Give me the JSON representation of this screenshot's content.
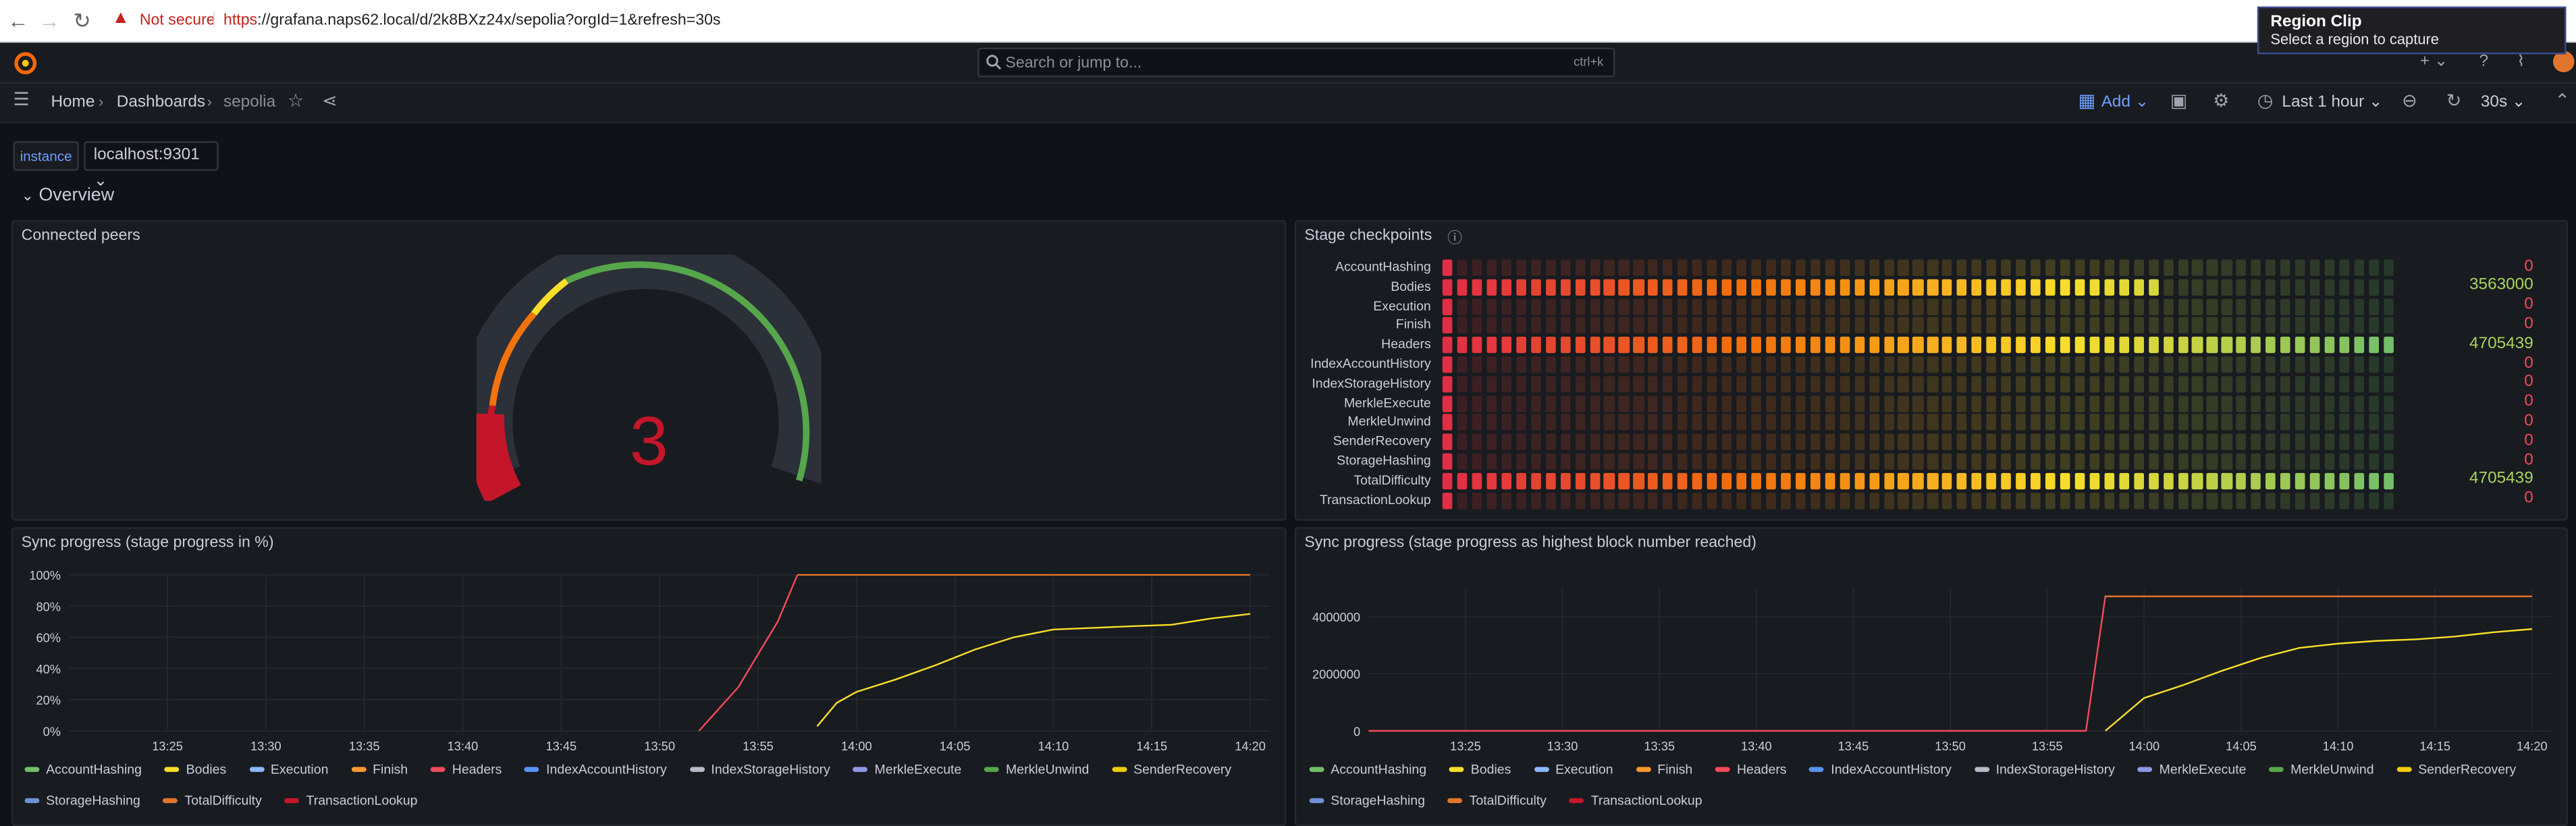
{
  "browser": {
    "security": "Not secure",
    "url_scheme": "https",
    "url_rest": "://grafana.naps62.local/d/2k8BXz24x/sepolia?orgId=1&refresh=30s"
  },
  "topbar": {
    "search_placeholder": "Search or jump to...",
    "search_shortcut": "ctrl+k"
  },
  "tooltip": {
    "title": "Region Clip",
    "subtitle": "Select a region to capture"
  },
  "breadcrumb": {
    "home": "Home",
    "dashboards": "Dashboards",
    "current": "sepolia"
  },
  "toolbar": {
    "add_label": "Add",
    "time_range": "Last 1 hour",
    "refresh_interval": "30s"
  },
  "variables": {
    "label": "instance",
    "value": "localhost:9301"
  },
  "row": {
    "title": "Overview"
  },
  "panels": {
    "peers": {
      "title": "Connected peers",
      "value": "3",
      "fraction": 0.03
    },
    "checkpoints": {
      "title": "Stage checkpoints",
      "stages": [
        {
          "name": "AccountHashing",
          "value": "0",
          "filled": 1
        },
        {
          "name": "Bodies",
          "value": "3563000",
          "filled": 0.757
        },
        {
          "name": "Execution",
          "value": "0",
          "filled": 1
        },
        {
          "name": "Finish",
          "value": "0",
          "filled": 1
        },
        {
          "name": "Headers",
          "value": "4705439",
          "filled": 1.0
        },
        {
          "name": "IndexAccountHistory",
          "value": "0",
          "filled": 1
        },
        {
          "name": "IndexStorageHistory",
          "value": "0",
          "filled": 1
        },
        {
          "name": "MerkleExecute",
          "value": "0",
          "filled": 1
        },
        {
          "name": "MerkleUnwind",
          "value": "0",
          "filled": 1
        },
        {
          "name": "SenderRecovery",
          "value": "0",
          "filled": 1
        },
        {
          "name": "StorageHashing",
          "value": "0",
          "filled": 1
        },
        {
          "name": "TotalDifficulty",
          "value": "4705439",
          "filled": 1.0
        },
        {
          "name": "TransactionLookup",
          "value": "0",
          "filled": 1
        }
      ]
    },
    "sync_pct": {
      "title": "Sync progress (stage progress in %)"
    },
    "sync_block": {
      "title": "Sync progress (stage progress as highest block number reached)"
    }
  },
  "legend": [
    {
      "name": "AccountHashing",
      "color": "#73bf69"
    },
    {
      "name": "Bodies",
      "color": "#fade2a"
    },
    {
      "name": "Execution",
      "color": "#8ab8ff"
    },
    {
      "name": "Finish",
      "color": "#ff9830"
    },
    {
      "name": "Headers",
      "color": "#f2495c"
    },
    {
      "name": "IndexAccountHistory",
      "color": "#5794f2"
    },
    {
      "name": "IndexStorageHistory",
      "color": "#b8bcc9"
    },
    {
      "name": "MerkleExecute",
      "color": "#8f97e6"
    },
    {
      "name": "MerkleUnwind",
      "color": "#56a64b"
    },
    {
      "name": "SenderRecovery",
      "color": "#f2cc0c"
    },
    {
      "name": "StorageHashing",
      "color": "#6e92d5"
    },
    {
      "name": "TotalDifficulty",
      "color": "#e0752d"
    },
    {
      "name": "TransactionLookup",
      "color": "#c4162a"
    }
  ],
  "chart_data": [
    {
      "type": "line",
      "title": "Sync progress (stage progress in %)",
      "x_ticks": [
        "13:25",
        "13:30",
        "13:35",
        "13:40",
        "13:45",
        "13:50",
        "13:55",
        "14:00",
        "14:05",
        "14:10",
        "14:15",
        "14:20"
      ],
      "y_ticks": [
        "0%",
        "20%",
        "40%",
        "60%",
        "80%",
        "100%"
      ],
      "ylim": [
        0,
        100
      ],
      "series": [
        {
          "name": "Headers",
          "color": "#f2495c",
          "points": [
            [
              "13:52",
              0
            ],
            [
              "13:54",
              28
            ],
            [
              "13:56",
              70
            ],
            [
              "13:57",
              100
            ]
          ]
        },
        {
          "name": "TotalDifficulty",
          "color": "#e0752d",
          "points": [
            [
              "13:57",
              100
            ],
            [
              "14:20",
              100
            ]
          ]
        },
        {
          "name": "Bodies",
          "color": "#fade2a",
          "points": [
            [
              "13:58",
              3
            ],
            [
              "13:59",
              18
            ],
            [
              "14:00",
              25
            ],
            [
              "14:02",
              33
            ],
            [
              "14:04",
              42
            ],
            [
              "14:06",
              52
            ],
            [
              "14:08",
              60
            ],
            [
              "14:10",
              65
            ],
            [
              "14:12",
              66
            ],
            [
              "14:14",
              67
            ],
            [
              "14:16",
              68
            ],
            [
              "14:18",
              72
            ],
            [
              "14:20",
              75
            ]
          ]
        }
      ]
    },
    {
      "type": "line",
      "title": "Sync progress (stage progress as highest block number reached)",
      "x_ticks": [
        "13:25",
        "13:30",
        "13:35",
        "13:40",
        "13:45",
        "13:50",
        "13:55",
        "14:00",
        "14:05",
        "14:10",
        "14:15",
        "14:20"
      ],
      "y_ticks": [
        "0",
        "2000000",
        "4000000"
      ],
      "ylim": [
        0,
        5000000
      ],
      "series": [
        {
          "name": "Headers",
          "color": "#f2495c",
          "points": [
            [
              "13:20",
              0
            ],
            [
              "13:57",
              0
            ],
            [
              "13:58",
              4705439
            ],
            [
              "14:20",
              4705439
            ]
          ]
        },
        {
          "name": "TotalDifficulty",
          "color": "#e0752d",
          "points": [
            [
              "13:58",
              4705439
            ],
            [
              "14:20",
              4705439
            ]
          ]
        },
        {
          "name": "Bodies",
          "color": "#fade2a",
          "points": [
            [
              "13:58",
              0
            ],
            [
              "14:00",
              1150000
            ],
            [
              "14:02",
              1600000
            ],
            [
              "14:04",
              2100000
            ],
            [
              "14:06",
              2550000
            ],
            [
              "14:08",
              2900000
            ],
            [
              "14:10",
              3050000
            ],
            [
              "14:12",
              3150000
            ],
            [
              "14:14",
              3200000
            ],
            [
              "14:16",
              3300000
            ],
            [
              "14:18",
              3450000
            ],
            [
              "14:20",
              3563000
            ]
          ]
        }
      ]
    }
  ]
}
